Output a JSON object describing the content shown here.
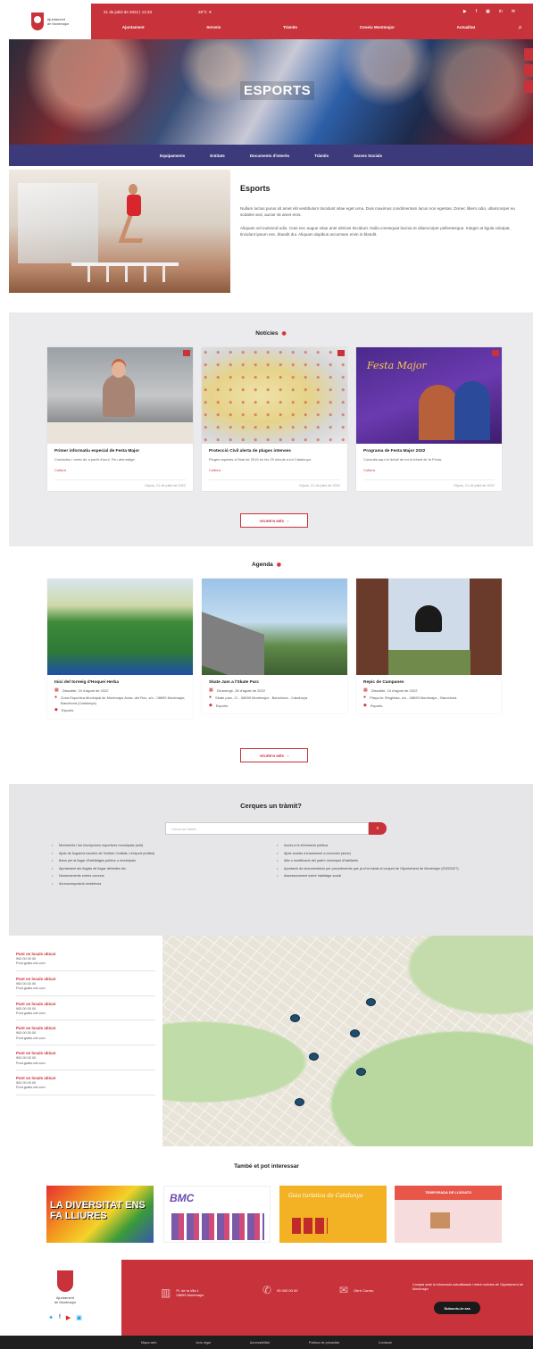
{
  "header": {
    "logo_line1": "Ajuntament",
    "logo_line2": "de Montmajor",
    "date": "21 de juliol de 2022 | 12:33",
    "weather": "28°C ☀",
    "social": [
      "▶",
      "f",
      "▣",
      "in",
      "✉"
    ],
    "nav": [
      "Ajuntament",
      "Serveis",
      "Tràmits",
      "Coneix Montmajor",
      "Actualitat"
    ]
  },
  "hero": {
    "title": "ESPORTS"
  },
  "subnav": [
    "Equipaments",
    "Entitats",
    "Documents d'interès",
    "Tràmits",
    "Xarxes Socials"
  ],
  "intro": {
    "title": "Esports",
    "p1": "Nullam luctus purus sit amet elit vestibulum tincidunt vitae eget urna. Duis maximus condimentum lacus non egestas. Donec libero odio, ullamcorper eu sodales sed, auctor sit amet eros.",
    "p2": "Aliquam vel euismod odio. Cras nec augue vitae ante ultrices tincidunt. Nulla consequat lacinia et ullamcorper pellentesque. Integer at ligula volutpat, tincidunt ipsum nec, blandit dui. Aliquam dapibus accumsan enim in blandit."
  },
  "news": {
    "title": "Notícies",
    "more": "VEURE'N MÉS",
    "items": [
      {
        "title": "Primer informatiu especial de Festa Major",
        "text": "Contacteu i veieu de a partir d'avui. Feu aformatge.",
        "cat": "Cultura",
        "date": "Dijous, 21 de juliol de 2022"
      },
      {
        "title": "Protecció Civil alerta de pluges intenses",
        "text": "Pluges aquests al final de 2015 en les 20 minuts a tot Catalunya.",
        "cat": "Cultura",
        "date": "Dijous, 21 de juliol de 2022"
      },
      {
        "title": "Programa de Festa Major 2022",
        "text": "Consulta aquí el detall de tot el tràmit de la Festa.",
        "cat": "Cultura",
        "date": "Dijous, 21 de juliol de 2022"
      }
    ]
  },
  "agenda": {
    "title": "Agenda",
    "more": "VEURE'N MÉS",
    "items": [
      {
        "title": "Inici del torneig d'Hoquei Herba",
        "date": "Dissabte, 24 d'agost de 2022",
        "place": "Zona Esportiva Municipal de Montmajor Avda. del Roc, s/n - 08699 Montmajor, Barcelona (Catalunya)",
        "cat": "Esports"
      },
      {
        "title": "Skate Jam a l'Skate Parc",
        "date": "Diumenge, 28 d'agost de 2022",
        "place": "Skate parc, C/ - 08699 Montmajor - Barcelona - Catalunya",
        "cat": "Esports"
      },
      {
        "title": "Repic de Campanes",
        "date": "Dissabte, 24 d'agost de 2022",
        "place": "Plaça de l'Església, s/n - 08699 Montmajor - Barcelona",
        "cat": "Esports"
      }
    ]
  },
  "tramit": {
    "title": "Cerques un tràmit?",
    "placeholder": "Cerca un tràmit...",
    "left": [
      "Moviments i las inscripcions esportives municipals (anti)",
      "Ajuts de lloguer/a escoles de l'entitat i entitats i d'esport (entitat)",
      "Bans per al llogar d'habitatges públics o municipals",
      "Ajuntament als llogats de llogar delimites etc",
      "Nomenaments entres comuns",
      "Acreucomposició residència"
    ],
    "right": [
      "Accés a la informació pública",
      "Ajuts socials a tractament a comunes (anne)",
      "Alta o modificació del padró municipal d'habitants",
      "Aportació de documentació per procediments que ja s'ha iniciat al conjunt de l'Ajuntament de Montmajor (20220327)",
      "Assessorament sobre habitatge social"
    ]
  },
  "contacts": [
    {
      "name": "Punt on locals ubicat",
      "phone": "900 00 00 00",
      "web": "Punt.gratis.net.com"
    },
    {
      "name": "Punt on locals ubicat",
      "phone": "900 00 00 00",
      "web": "Punt.gratis.net.com"
    },
    {
      "name": "Punt on locals ubicat",
      "phone": "900 00 00 00",
      "web": "Punt.gratis.net.com"
    },
    {
      "name": "Punt on locals ubicat",
      "phone": "900 00 00 00",
      "web": "Punt.gratis.net.com"
    },
    {
      "name": "Punt on locals ubicat",
      "phone": "900 00 00 00",
      "web": "Punt.gratis.net.com"
    },
    {
      "name": "Punt on locals ubicat",
      "phone": "900 00 00 00",
      "web": "Punt.gratis.net.com"
    }
  ],
  "interest": {
    "title": "També et pot interessar",
    "b1": "LA DIVERSITAT ENS FA LLIURES",
    "b2": "BMC",
    "b3": "Guia turística de Catalunya",
    "b4": "TEMPORADA DE LLEGATS"
  },
  "footer": {
    "name1": "Ajuntament",
    "name2": "de Montmajor",
    "address1": "Pl. de la Vila 1",
    "address2": "08699 Montmajor",
    "phone": "93 000 00 00",
    "email": "Obrir Correu",
    "newsletter": "Compta amb la informació actualitzada i rebrà notícies de l'Ajuntament de Montmajor",
    "subscribe": "Subscriu-te ara",
    "links": [
      "Mapa web",
      "Avís legal",
      "Accessibilitat",
      "Política de privacitat",
      "Contacte"
    ]
  }
}
